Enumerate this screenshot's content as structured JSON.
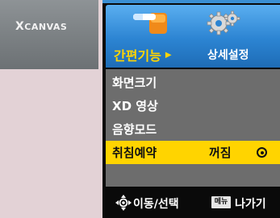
{
  "brand": {
    "logo_initial": "X",
    "logo_rest": "CANVAS"
  },
  "header": {
    "tab_ease": {
      "label": "간편기능",
      "arrow": "▶",
      "icon": "hand-pointer-icon"
    },
    "tab_settings": {
      "label": "상세설정",
      "icon": "gears-icon"
    }
  },
  "menu": {
    "items": [
      {
        "label": "화면크기",
        "selected": false
      },
      {
        "label": "XD 영상",
        "selected": false
      },
      {
        "label": "음향모드",
        "selected": false
      },
      {
        "label": "취침예약",
        "value": "꺼짐",
        "selected": true
      }
    ]
  },
  "footer": {
    "nav_label": "이동/선택",
    "menu_key": "메뉴",
    "exit_label": "나가기"
  },
  "colors": {
    "highlight": "#ffd400",
    "header_blue": "#2c84d2",
    "list_bg": "#6d6d6d",
    "page_bg": "#e3d2d6"
  }
}
